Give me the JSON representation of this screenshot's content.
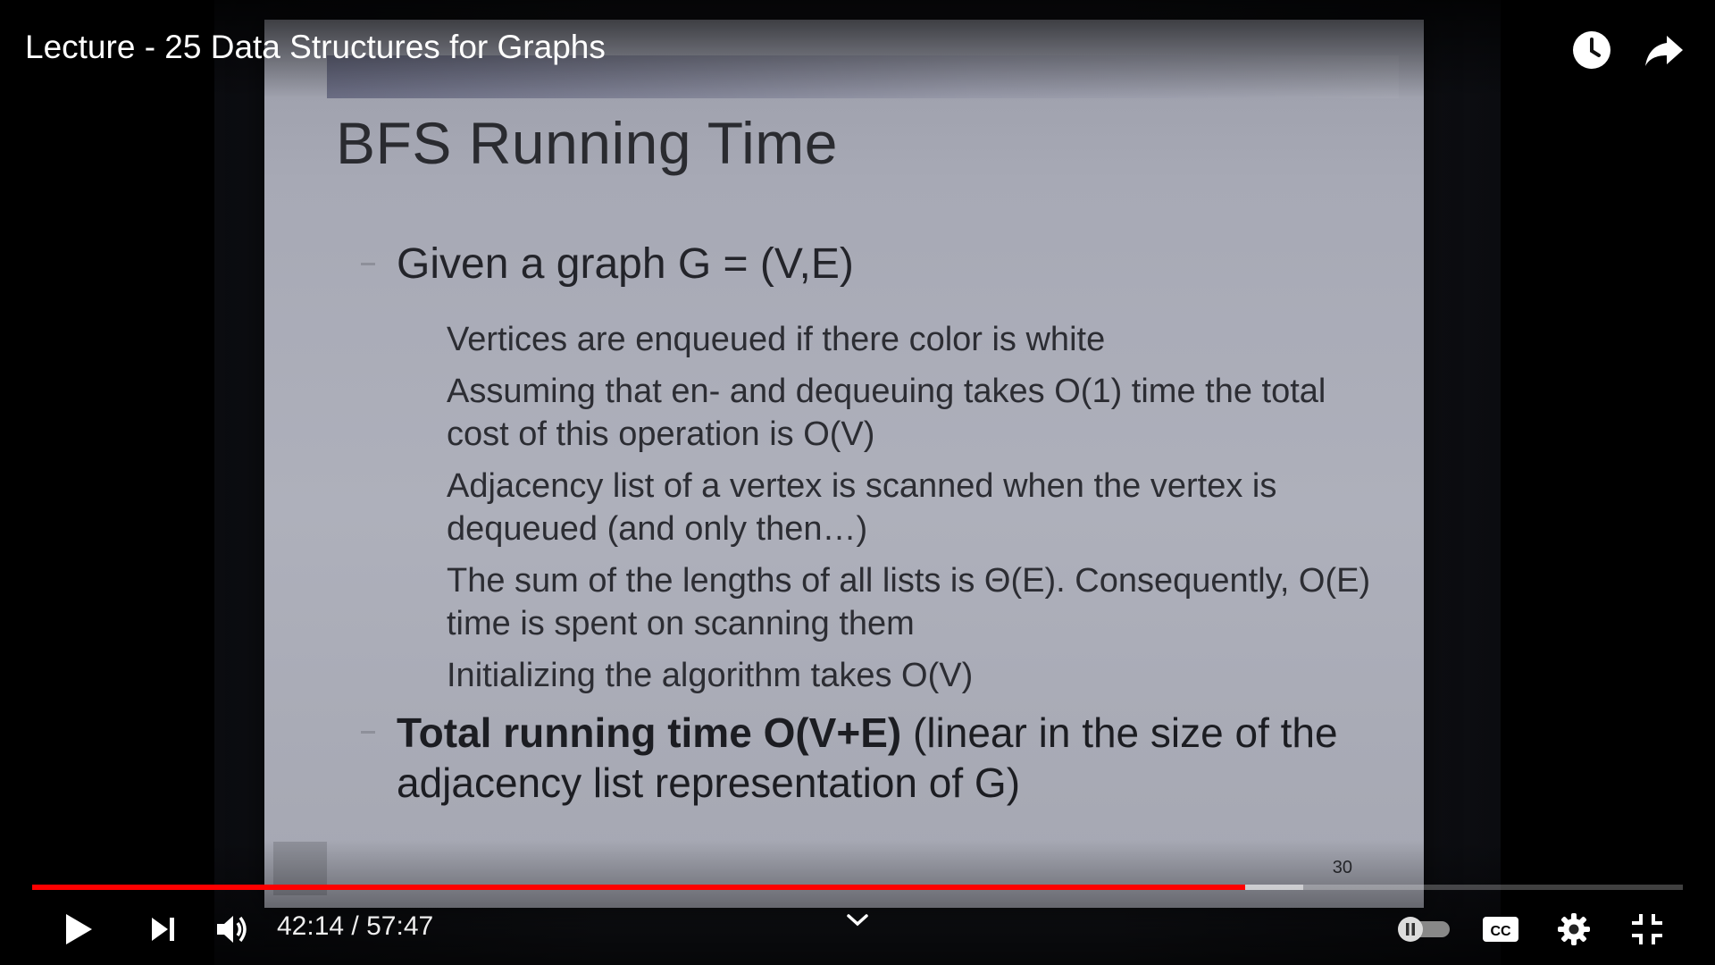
{
  "video": {
    "title": "Lecture - 25 Data Structures for Graphs",
    "time_current": "42:14",
    "time_separator": "/",
    "time_total": "57:47",
    "progress_played": 0.735,
    "progress_buffered": 0.77
  },
  "slide": {
    "title": "BFS Running Time",
    "bullet1": "Given a graph G = (V,E)",
    "sub_items": [
      "Vertices are enqueued if there color is white",
      "Assuming that en- and dequeuing takes O(1) time the total cost of this operation is O(V)",
      "Adjacency list of a vertex is scanned when the vertex is dequeued (and only then…)",
      "The sum of the lengths of all lists is Θ(E). Consequently, O(E) time is spent on scanning them",
      "Initializing the algorithm takes O(V)"
    ],
    "bullet2_bold": "Total running time O(V+E)",
    "bullet2_rest": " (linear in the size of the adjacency list representation of G)",
    "page_number": "30"
  },
  "icons": {
    "watch_later": "clock-icon",
    "share": "share-icon",
    "play": "play-icon",
    "next": "next-icon",
    "volume": "volume-icon",
    "chevron": "chevron-down-icon",
    "autoplay": "autoplay-toggle",
    "captions": "cc-icon",
    "settings": "gear-icon",
    "exit_fullscreen": "exit-fullscreen-icon"
  },
  "colors": {
    "progress": "#ff0000",
    "text": "#ffffff"
  }
}
